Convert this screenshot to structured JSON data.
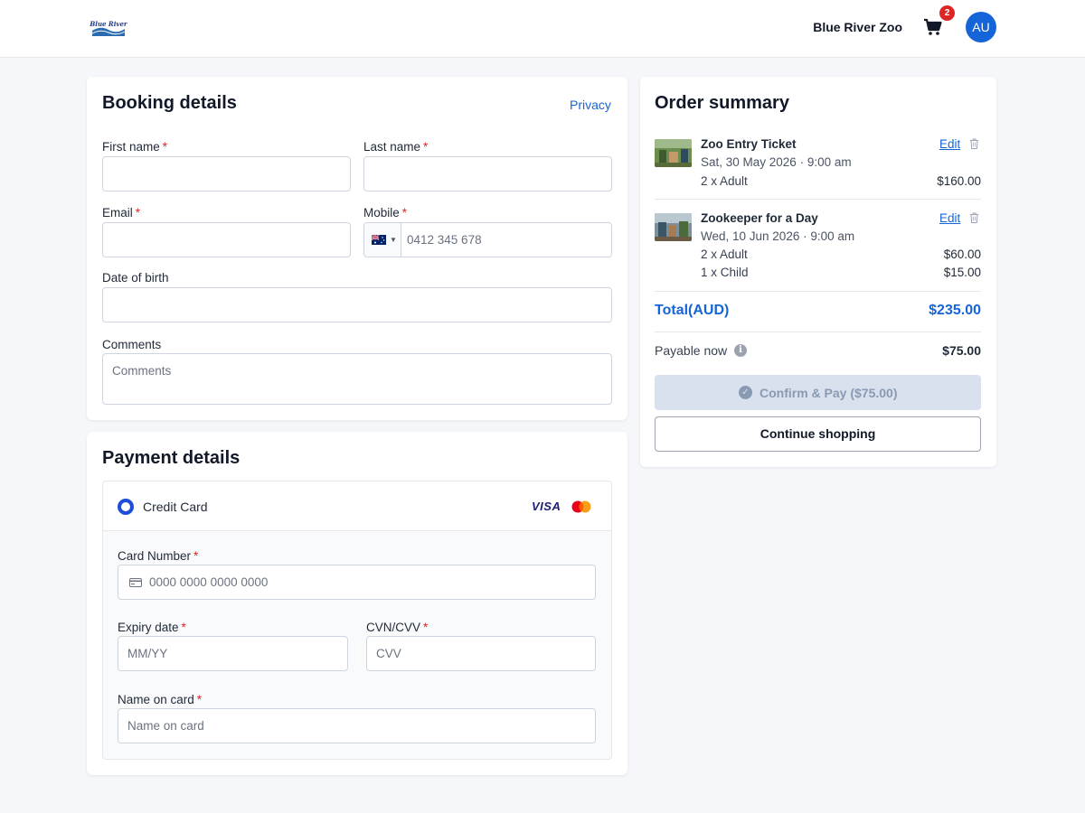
{
  "header": {
    "logo_text": "Blue River",
    "brand": "Blue River Zoo",
    "cart_icon": "cart-icon",
    "cart_count": "2",
    "avatar_initials": "AU"
  },
  "booking": {
    "title": "Booking details",
    "privacy_link": "Privacy",
    "required_mark": "*",
    "first_name": {
      "label": "First name",
      "value": ""
    },
    "last_name": {
      "label": "Last name",
      "value": ""
    },
    "email": {
      "label": "Email",
      "value": ""
    },
    "mobile": {
      "label": "Mobile",
      "placeholder": "0412 345 678",
      "country_icon": "australia-flag-icon"
    },
    "dob": {
      "label": "Date of birth",
      "value": ""
    },
    "comments": {
      "label": "Comments",
      "placeholder": "Comments"
    }
  },
  "payment": {
    "title": "Payment details",
    "method_label": "Credit Card",
    "brands": [
      "VISA",
      "mastercard-icon"
    ],
    "card_number": {
      "label": "Card Number",
      "placeholder": "0000 0000 0000 0000",
      "icon": "credit-card-icon"
    },
    "expiry": {
      "label": "Expiry date",
      "placeholder": "MM/YY"
    },
    "cvv": {
      "label": "CVN/CVV",
      "placeholder": "CVV"
    },
    "name_on_card": {
      "label": "Name on card",
      "placeholder": "Name on card"
    }
  },
  "order": {
    "title": "Order summary",
    "edit_label": "Edit",
    "items": [
      {
        "title": "Zoo Entry Ticket",
        "date": "Sat, 30 May 2026 · 9:00 am",
        "lines": [
          {
            "label": "2 x Adult",
            "price": "$160.00"
          }
        ]
      },
      {
        "title": "Zookeeper for a Day",
        "date": "Wed, 10 Jun 2026 · 9:00 am",
        "lines": [
          {
            "label": "2 x Adult",
            "price": "$60.00"
          },
          {
            "label": "1 x Child",
            "price": "$15.00"
          }
        ]
      }
    ],
    "total_label": "Total(AUD)",
    "total_value": "$235.00",
    "payable_label": "Payable now",
    "payable_value": "$75.00",
    "confirm_button": "Confirm & Pay ($75.00)",
    "continue_button": "Continue shopping"
  },
  "colors": {
    "accent": "#1565d8",
    "required": "#dc2626",
    "badge": "#dc2626",
    "disabled_button": "#d9e1ee"
  }
}
